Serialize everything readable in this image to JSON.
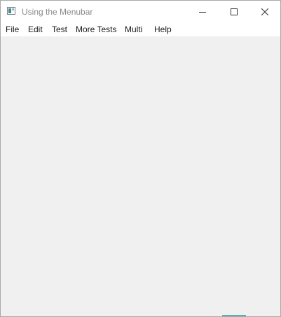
{
  "window": {
    "title": "Using the Menubar"
  },
  "icons": {
    "app": "app-window-icon",
    "minimize": "minimize-icon",
    "maximize": "maximize-icon",
    "close": "close-icon"
  },
  "menubar": {
    "items": [
      {
        "label": "File"
      },
      {
        "label": "Edit"
      },
      {
        "label": "Test"
      },
      {
        "label": "More Tests"
      },
      {
        "label": "Multi"
      },
      {
        "label": "Help"
      }
    ]
  },
  "colors": {
    "client_background": "#f0f0f0",
    "titlebar_background": "#ffffff",
    "title_text": "#8a8a8a",
    "accent": "#53b3b0"
  }
}
